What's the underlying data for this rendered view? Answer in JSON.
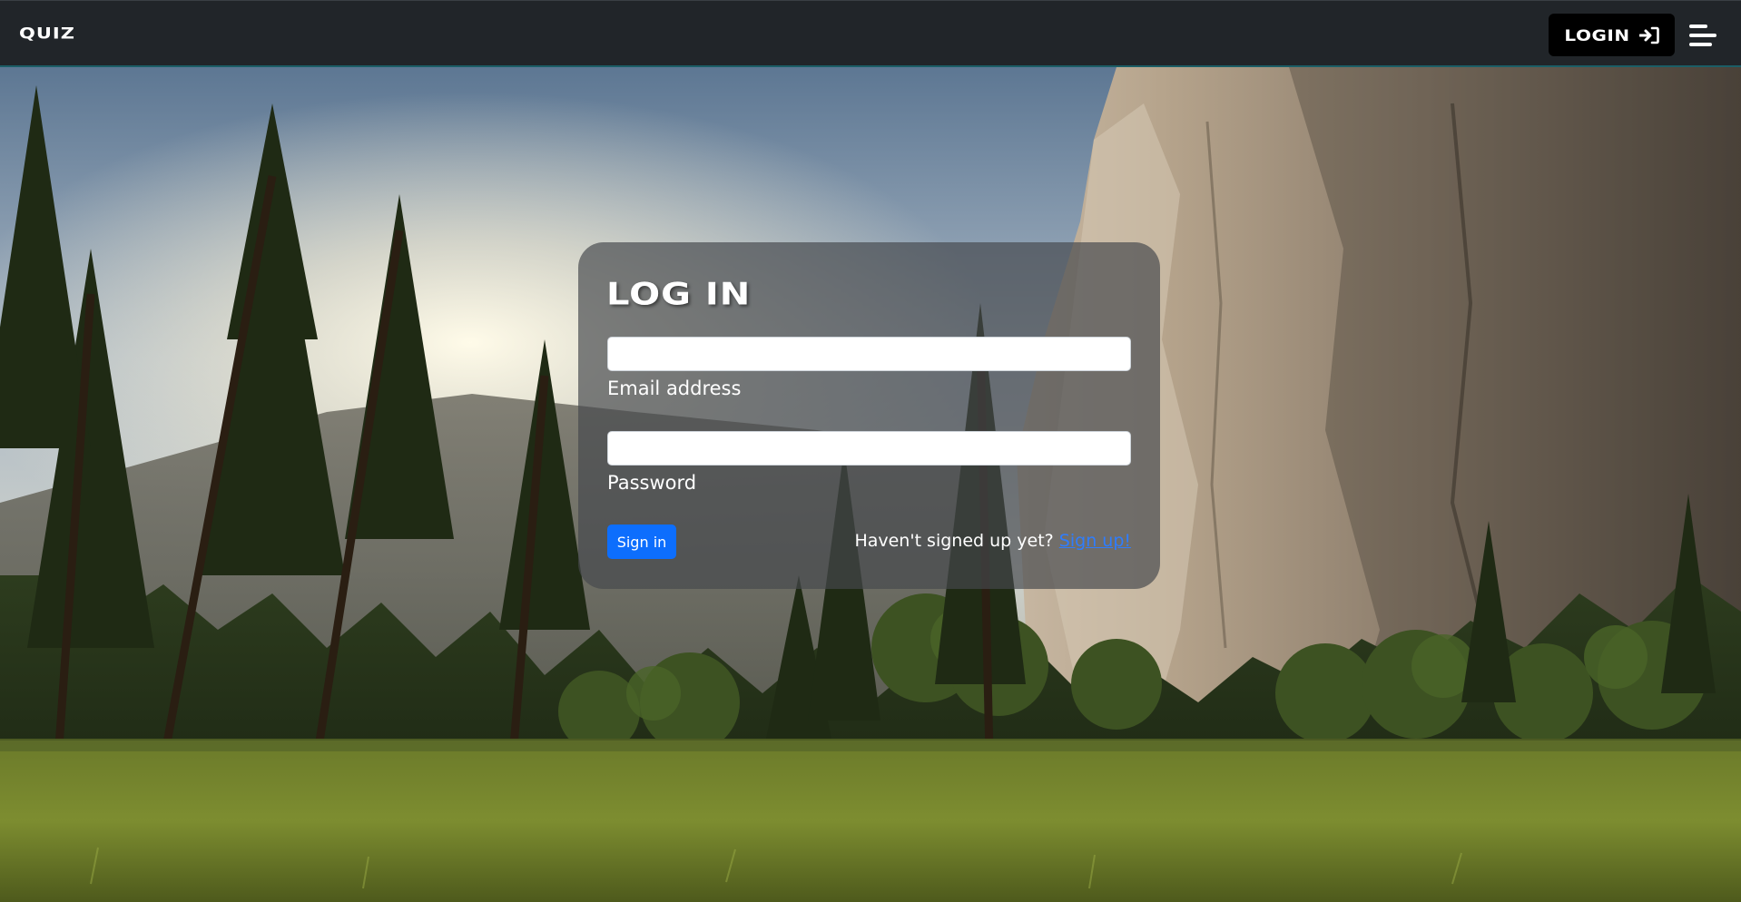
{
  "navbar": {
    "brand": "QUIZ",
    "login_label": "LOGIN",
    "login_icon": "sign-in-arrow-icon",
    "menu_icon": "hamburger-menu-icon",
    "background_color": "#212529"
  },
  "login_card": {
    "title": "LOG IN",
    "email": {
      "label": "Email address",
      "value": "",
      "placeholder": ""
    },
    "password": {
      "label": "Password",
      "value": "",
      "placeholder": ""
    },
    "signin_label": "Sign in",
    "signup_prompt": "Haven't signed up yet?",
    "signup_link": "Sign up!"
  },
  "colors": {
    "primary_button": "#0d6efd",
    "link": "#2f7dfd",
    "navbar": "#212529"
  }
}
